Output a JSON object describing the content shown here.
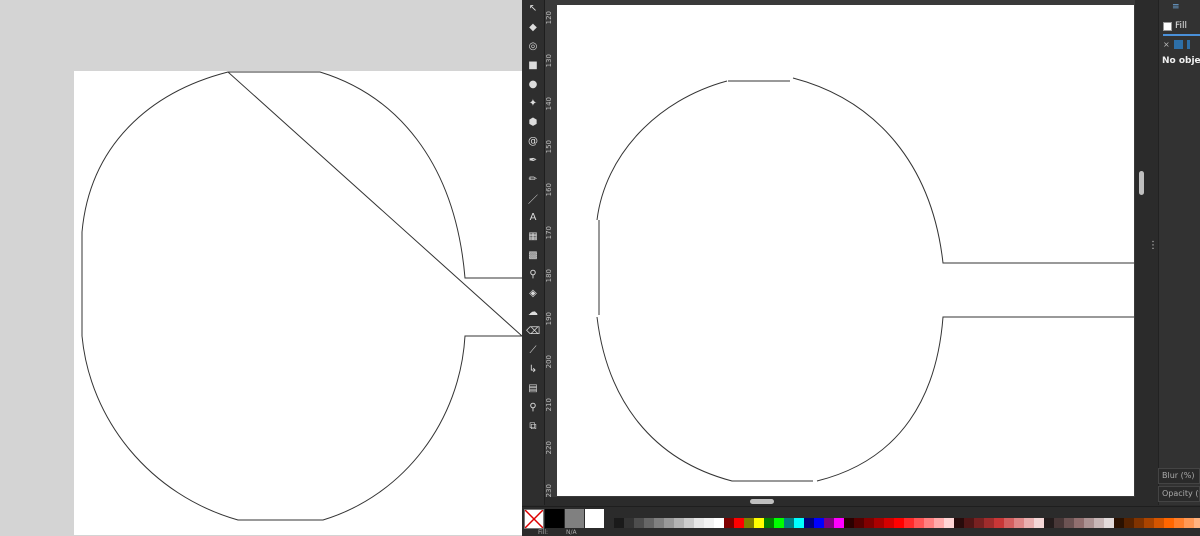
{
  "left_view": {
    "description_icon": "drawing-preview"
  },
  "toolbar": {
    "tools": [
      {
        "name": "selector-tool",
        "glyph": "↖"
      },
      {
        "name": "node-tool",
        "glyph": "◆"
      },
      {
        "name": "tweak-tool",
        "glyph": "◎"
      },
      {
        "name": "rectangle-tool",
        "glyph": "■"
      },
      {
        "name": "ellipse-tool",
        "glyph": "●"
      },
      {
        "name": "star-tool",
        "glyph": "✦"
      },
      {
        "name": "3d-box-tool",
        "glyph": "⬢"
      },
      {
        "name": "spiral-tool",
        "glyph": "@"
      },
      {
        "name": "pen-tool",
        "glyph": "✒"
      },
      {
        "name": "pencil-tool",
        "glyph": "✏"
      },
      {
        "name": "calligraphy-tool",
        "glyph": "／"
      },
      {
        "name": "text-tool",
        "glyph": "A"
      },
      {
        "name": "gradient-tool",
        "glyph": "▦"
      },
      {
        "name": "mesh-tool",
        "glyph": "▩"
      },
      {
        "name": "dropper-tool",
        "glyph": "⚲"
      },
      {
        "name": "paint-bucket-tool",
        "glyph": "◈"
      },
      {
        "name": "spray-tool",
        "glyph": "☁"
      },
      {
        "name": "eraser-tool",
        "glyph": "⌫"
      },
      {
        "name": "measure-tool",
        "glyph": "⟋"
      },
      {
        "name": "connector-tool",
        "glyph": "↳"
      },
      {
        "name": "pages-tool",
        "glyph": "▤"
      },
      {
        "name": "zoom-tool",
        "glyph": "⚲"
      },
      {
        "name": "lpe-tool",
        "glyph": "⧉"
      }
    ]
  },
  "ruler": {
    "ticks": [
      "120",
      "130",
      "140",
      "150",
      "160",
      "170",
      "180",
      "190",
      "200",
      "210",
      "220",
      "230"
    ]
  },
  "panel": {
    "tab_label": "Fill",
    "close_glyph": "×",
    "empty_message": "No objects",
    "blur_label": "Blur (%)",
    "opacity_label": "Opacity (%)"
  },
  "palette": {
    "large_swatches": [
      "#000000",
      "#808080",
      "#ffffff"
    ],
    "colors": [
      "#1a1a1a",
      "#333333",
      "#4d4d4d",
      "#666666",
      "#808080",
      "#999999",
      "#b3b3b3",
      "#cccccc",
      "#e6e6e6",
      "#f2f2f2",
      "#ffffff",
      "#800000",
      "#ff0000",
      "#808000",
      "#ffff00",
      "#008000",
      "#00ff00",
      "#008080",
      "#00ffff",
      "#000080",
      "#0000ff",
      "#800080",
      "#ff00ff",
      "#2b0000",
      "#550000",
      "#800000",
      "#aa0000",
      "#d40000",
      "#ff0000",
      "#ff2a2a",
      "#ff5555",
      "#ff8080",
      "#ffaaaa",
      "#ffd5d5",
      "#280b0b",
      "#501616",
      "#782121",
      "#a02c2c",
      "#c83737",
      "#d35f5f",
      "#de8787",
      "#e9afaf",
      "#f4d7d7",
      "#241c1c",
      "#483737",
      "#6c5353",
      "#916f6f",
      "#ac9393",
      "#c8b7b7",
      "#e3dbdb",
      "#2b1100",
      "#552200",
      "#803300",
      "#aa4400",
      "#d45500",
      "#ff6600",
      "#ff7f2a",
      "#ff9955",
      "#ffb380"
    ]
  },
  "status": {
    "fill_label": "Fill:",
    "fill_value": "N/A"
  }
}
